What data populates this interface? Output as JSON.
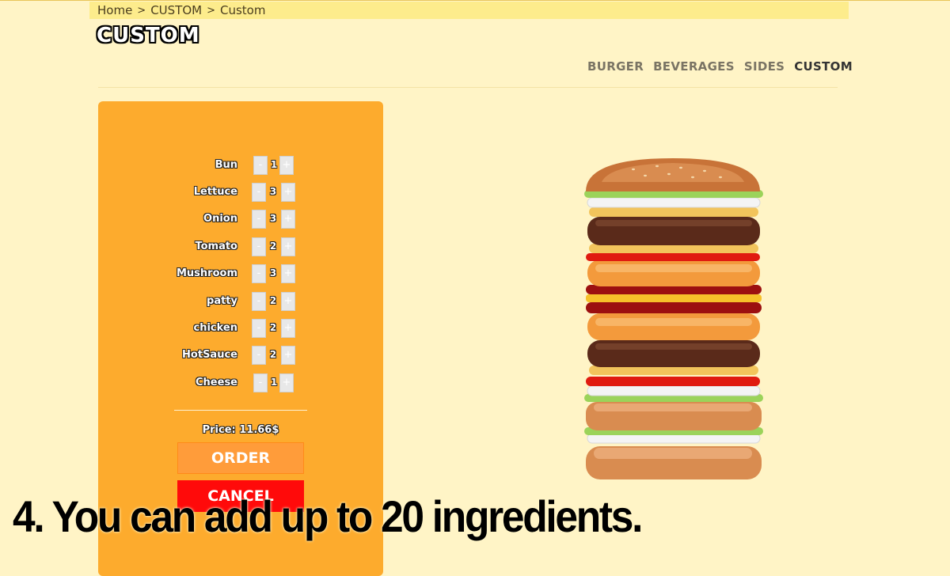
{
  "breadcrumb": {
    "items": [
      "Home",
      "CUSTOM",
      "Custom"
    ],
    "separator": ">"
  },
  "logo": {
    "text": "CUSTOM"
  },
  "nav": {
    "items": [
      "BURGER",
      "BEVERAGES",
      "SIDES",
      "CUSTOM"
    ],
    "active": "CUSTOM"
  },
  "ingredients": [
    {
      "name": "Bun",
      "count": "1"
    },
    {
      "name": "Lettuce",
      "count": "3"
    },
    {
      "name": "Onion",
      "count": "3"
    },
    {
      "name": "Tomato",
      "count": "2"
    },
    {
      "name": "Mushroom",
      "count": "3"
    },
    {
      "name": "patty",
      "count": "2"
    },
    {
      "name": "chicken",
      "count": "2"
    },
    {
      "name": "HotSauce",
      "count": "2"
    },
    {
      "name": "Cheese",
      "count": "1"
    }
  ],
  "controls": {
    "minus": "-",
    "plus": "+"
  },
  "price": "Price: 11.66$",
  "buttons": {
    "order": "ORDER",
    "cancel": "CANCEL"
  },
  "caption": "4. You can add up to 20 ingredients.",
  "colors": {
    "panel": "#fdab2d",
    "order": "#ff9c3a",
    "cancel": "#ff0a0a",
    "background": "#fff4c6",
    "breadcrumb": "#fdec8c"
  }
}
